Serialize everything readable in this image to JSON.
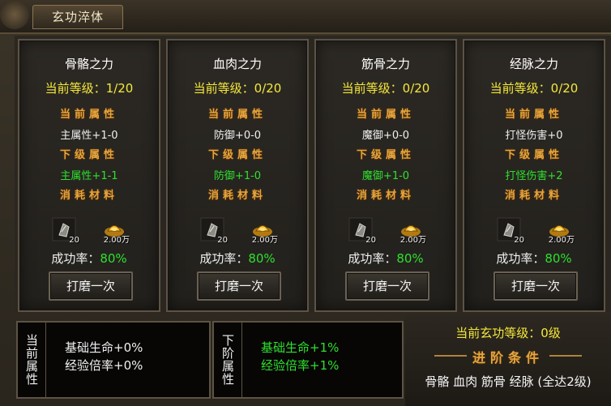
{
  "window": {
    "title": "玄功淬体"
  },
  "cards": [
    {
      "name": "骨骼之力",
      "level": "当前等级：1/20",
      "cur_header": "当前属性",
      "cur_attr": "主属性+1-0",
      "next_header": "下级属性",
      "next_attr": "主属性+1-1",
      "mat_header": "消耗材料",
      "item1_count": "20",
      "item2_count": "2.00万",
      "rate_label": "成功率：",
      "rate_value": "80%",
      "button": "打磨一次"
    },
    {
      "name": "血肉之力",
      "level": "当前等级：0/20",
      "cur_header": "当前属性",
      "cur_attr": "防御+0-0",
      "next_header": "下级属性",
      "next_attr": "防御+1-0",
      "mat_header": "消耗材料",
      "item1_count": "20",
      "item2_count": "2.00万",
      "rate_label": "成功率：",
      "rate_value": "80%",
      "button": "打磨一次"
    },
    {
      "name": "筋骨之力",
      "level": "当前等级：0/20",
      "cur_header": "当前属性",
      "cur_attr": "魔御+0-0",
      "next_header": "下级属性",
      "next_attr": "魔御+1-0",
      "mat_header": "消耗材料",
      "item1_count": "20",
      "item2_count": "2.00万",
      "rate_label": "成功率：",
      "rate_value": "80%",
      "button": "打磨一次"
    },
    {
      "name": "经脉之力",
      "level": "当前等级：0/20",
      "cur_header": "当前属性",
      "cur_attr": "打怪伤害+0",
      "next_header": "下级属性",
      "next_attr": "打怪伤害+2",
      "mat_header": "消耗材料",
      "item1_count": "20",
      "item2_count": "2.00万",
      "rate_label": "成功率：",
      "rate_value": "80%",
      "button": "打磨一次"
    }
  ],
  "current_attrs": {
    "label": "当前属性",
    "line1": "基础生命+0%",
    "line2": "经验倍率+0%"
  },
  "next_attrs": {
    "label": "下阶属性",
    "line1": "基础生命+1%",
    "line2": "经验倍率+1%"
  },
  "advance": {
    "level": "当前玄功等级：0级",
    "header": "进阶条件",
    "requirement": "骨骼 血肉 筋骨 经脉 (全达2级)"
  },
  "colors": {
    "yellow": "#f5e83a",
    "green": "#2ee02e",
    "gold": "#e3a53e"
  }
}
